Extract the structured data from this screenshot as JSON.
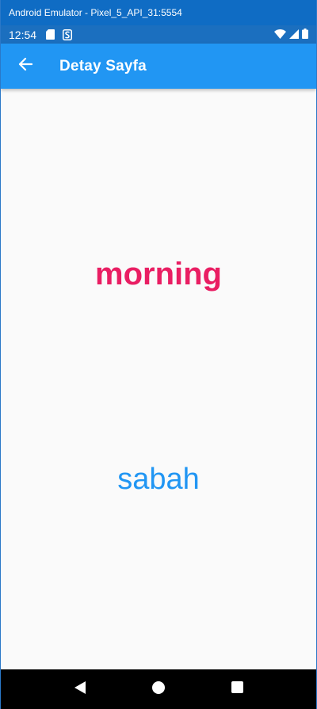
{
  "window": {
    "title": "Android Emulator - Pixel_5_API_31:5554"
  },
  "status_bar": {
    "time": "12:54",
    "icons": [
      "sd-card-icon",
      "s-notification-icon"
    ],
    "right_icons": [
      "wifi-icon",
      "cell-signal-icon",
      "battery-icon"
    ]
  },
  "app_bar": {
    "back_icon": "arrow-back-icon",
    "title": "Detay Sayfa"
  },
  "content": {
    "english_word": "morning",
    "turkish_word": "sabah"
  },
  "nav_bar": {
    "icons": [
      "back-triangle-icon",
      "home-circle-icon",
      "recents-square-icon"
    ]
  },
  "colors": {
    "app_bar": "#2196f3",
    "english_word": "#e91e63",
    "turkish_word": "#2196f3",
    "nav_bar": "#000000"
  }
}
